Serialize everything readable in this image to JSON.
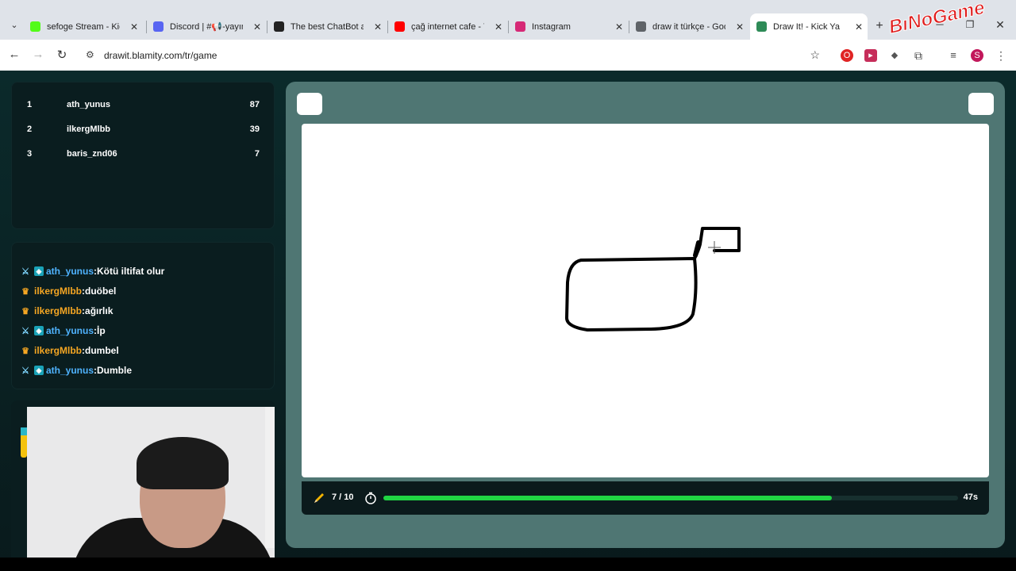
{
  "browser": {
    "tabs": [
      {
        "label": "sefoge Stream - Kick",
        "icon": "kick-icon",
        "color": "#53fc18"
      },
      {
        "label": "Discord | #📢-yayın",
        "icon": "discord-icon",
        "color": "#5865f2"
      },
      {
        "label": "The best ChatBot and",
        "icon": "chatbot-icon",
        "color": "#222222"
      },
      {
        "label": "çağ internet cafe - Yo",
        "icon": "youtube-icon",
        "color": "#ff0000"
      },
      {
        "label": "Instagram",
        "icon": "instagram-icon",
        "color": "#d62976"
      },
      {
        "label": "draw it türkçe - Goog",
        "icon": "globe-icon",
        "color": "#5f6368"
      },
      {
        "label": "Draw It! - Kick Ya",
        "icon": "drawit-icon",
        "color": "#2e8b57",
        "active": true
      }
    ],
    "url": "drawit.blamity.com/tr/game",
    "profile_initial": "S",
    "logo_text": "BıNoGame"
  },
  "leaderboard": [
    {
      "rank": "1",
      "name": "ath_yunus",
      "score": "87"
    },
    {
      "rank": "2",
      "name": "ilkergMlbb",
      "score": "39"
    },
    {
      "rank": "3",
      "name": "baris_znd06",
      "score": "7"
    }
  ],
  "chat": [
    {
      "badge": "sword",
      "user": "ath_yunus",
      "message": "Kötü iltifat olur",
      "user_color": "#4fb3ff"
    },
    {
      "badge": "crown",
      "user": "ilkergMlbb",
      "message": "duöbel",
      "user_color": "#f5a623"
    },
    {
      "badge": "crown",
      "user": "ilkergMlbb",
      "message": "ağırlık",
      "user_color": "#f5a623"
    },
    {
      "badge": "sword",
      "user": "ath_yunus",
      "message": "İp",
      "user_color": "#4fb3ff"
    },
    {
      "badge": "crown",
      "user": "ilkergMlbb",
      "message": "dumbel",
      "user_color": "#f5a623"
    },
    {
      "badge": "sword",
      "user": "ath_yunus",
      "message": "Dumble",
      "user_color": "#4fb3ff"
    }
  ],
  "game": {
    "round": "7 / 10",
    "time_left": "47s",
    "progress": 0.78,
    "accent": "#20d443"
  }
}
